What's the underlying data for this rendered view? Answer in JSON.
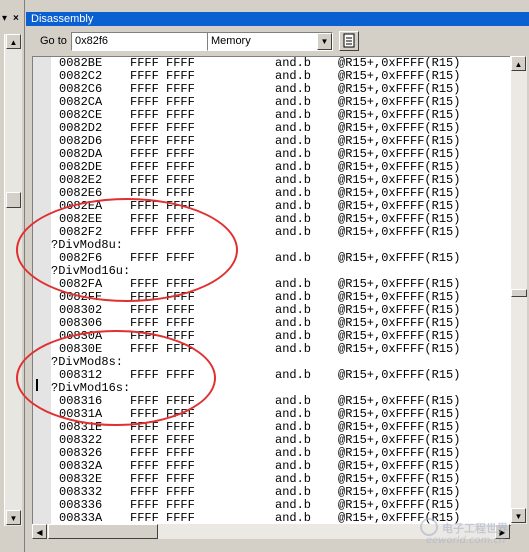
{
  "left_pane": {
    "dropdown_glyph": "▾",
    "close_glyph": "×"
  },
  "window": {
    "title": "Disassembly",
    "goto_label": "Go to",
    "goto_value": "0x82f6",
    "mode_value": "Memory"
  },
  "listing": [
    {
      "addr": "0082BE",
      "raw": "FFFF FFFF",
      "op": "and.b",
      "arg": "@R15+,0xFFFF(R15)"
    },
    {
      "addr": "0082C2",
      "raw": "FFFF FFFF",
      "op": "and.b",
      "arg": "@R15+,0xFFFF(R15)"
    },
    {
      "addr": "0082C6",
      "raw": "FFFF FFFF",
      "op": "and.b",
      "arg": "@R15+,0xFFFF(R15)"
    },
    {
      "addr": "0082CA",
      "raw": "FFFF FFFF",
      "op": "and.b",
      "arg": "@R15+,0xFFFF(R15)"
    },
    {
      "addr": "0082CE",
      "raw": "FFFF FFFF",
      "op": "and.b",
      "arg": "@R15+,0xFFFF(R15)"
    },
    {
      "addr": "0082D2",
      "raw": "FFFF FFFF",
      "op": "and.b",
      "arg": "@R15+,0xFFFF(R15)"
    },
    {
      "addr": "0082D6",
      "raw": "FFFF FFFF",
      "op": "and.b",
      "arg": "@R15+,0xFFFF(R15)"
    },
    {
      "addr": "0082DA",
      "raw": "FFFF FFFF",
      "op": "and.b",
      "arg": "@R15+,0xFFFF(R15)"
    },
    {
      "addr": "0082DE",
      "raw": "FFFF FFFF",
      "op": "and.b",
      "arg": "@R15+,0xFFFF(R15)"
    },
    {
      "addr": "0082E2",
      "raw": "FFFF FFFF",
      "op": "and.b",
      "arg": "@R15+,0xFFFF(R15)"
    },
    {
      "addr": "0082E6",
      "raw": "FFFF FFFF",
      "op": "and.b",
      "arg": "@R15+,0xFFFF(R15)"
    },
    {
      "addr": "0082EA",
      "raw": "FFFF FFFF",
      "op": "and.b",
      "arg": "@R15+,0xFFFF(R15)"
    },
    {
      "addr": "0082EE",
      "raw": "FFFF FFFF",
      "op": "and.b",
      "arg": "@R15+,0xFFFF(R15)"
    },
    {
      "addr": "0082F2",
      "raw": "FFFF FFFF",
      "op": "and.b",
      "arg": "@R15+,0xFFFF(R15)"
    },
    {
      "label": "?DivMod8u:"
    },
    {
      "addr": "0082F6",
      "raw": "FFFF FFFF",
      "op": "and.b",
      "arg": "@R15+,0xFFFF(R15)"
    },
    {
      "label": "?DivMod16u:"
    },
    {
      "addr": "0082FA",
      "raw": "FFFF FFFF",
      "op": "and.b",
      "arg": "@R15+,0xFFFF(R15)"
    },
    {
      "addr": "0082FE",
      "raw": "FFFF FFFF",
      "op": "and.b",
      "arg": "@R15+,0xFFFF(R15)"
    },
    {
      "addr": "008302",
      "raw": "FFFF FFFF",
      "op": "and.b",
      "arg": "@R15+,0xFFFF(R15)"
    },
    {
      "addr": "008306",
      "raw": "FFFF FFFF",
      "op": "and.b",
      "arg": "@R15+,0xFFFF(R15)"
    },
    {
      "addr": "00830A",
      "raw": "FFFF FFFF",
      "op": "and.b",
      "arg": "@R15+,0xFFFF(R15)"
    },
    {
      "addr": "00830E",
      "raw": "FFFF FFFF",
      "op": "and.b",
      "arg": "@R15+,0xFFFF(R15)"
    },
    {
      "label": "?DivMod8s:"
    },
    {
      "addr": "008312",
      "raw": "FFFF FFFF",
      "op": "and.b",
      "arg": "@R15+,0xFFFF(R15)"
    },
    {
      "label": "?DivMod16s:"
    },
    {
      "addr": "008316",
      "raw": "FFFF FFFF",
      "op": "and.b",
      "arg": "@R15+,0xFFFF(R15)"
    },
    {
      "addr": "00831A",
      "raw": "FFFF FFFF",
      "op": "and.b",
      "arg": "@R15+,0xFFFF(R15)"
    },
    {
      "addr": "00831E",
      "raw": "FFFF FFFF",
      "op": "and.b",
      "arg": "@R15+,0xFFFF(R15)"
    },
    {
      "addr": "008322",
      "raw": "FFFF FFFF",
      "op": "and.b",
      "arg": "@R15+,0xFFFF(R15)"
    },
    {
      "addr": "008326",
      "raw": "FFFF FFFF",
      "op": "and.b",
      "arg": "@R15+,0xFFFF(R15)"
    },
    {
      "addr": "00832A",
      "raw": "FFFF FFFF",
      "op": "and.b",
      "arg": "@R15+,0xFFFF(R15)"
    },
    {
      "addr": "00832E",
      "raw": "FFFF FFFF",
      "op": "and.b",
      "arg": "@R15+,0xFFFF(R15)"
    },
    {
      "addr": "008332",
      "raw": "FFFF FFFF",
      "op": "and.b",
      "arg": "@R15+,0xFFFF(R15)"
    },
    {
      "addr": "008336",
      "raw": "FFFF FFFF",
      "op": "and.b",
      "arg": "@R15+,0xFFFF(R15)"
    },
    {
      "addr": "00833A",
      "raw": "FFFF FFFF",
      "op": "and.b",
      "arg": "@R15+,0xFFFF(R15)"
    }
  ],
  "watermark": {
    "cn": "电子工程世界",
    "en": "eeworld.com.cn"
  },
  "colors": {
    "title_bar": "#0a5fd1",
    "annotation": "#e03030",
    "window_face": "#d4d0c8"
  },
  "icons": [
    "dropdown-arrow-icon",
    "close-icon",
    "scroll-up-icon",
    "scroll-down-icon",
    "scroll-left-icon",
    "scroll-right-icon",
    "document-icon"
  ]
}
